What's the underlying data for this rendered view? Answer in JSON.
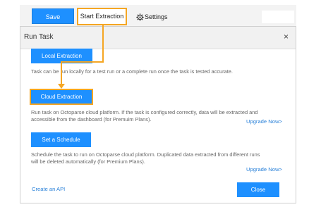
{
  "toolbar": {
    "save_label": "Save",
    "start_extraction_label": "Start Extraction",
    "settings_label": "Settings"
  },
  "dialog": {
    "title": "Run Task",
    "close_x": "×",
    "local": {
      "button_label": "Local Extraction",
      "description": "Task can be run locally for a test run or a complete run once the task is tested accurate."
    },
    "cloud": {
      "button_label": "Cloud Extraction",
      "description_line1": "Run task on Octoparse cloud platform. If the task is configured correctly, data will be extracted and",
      "description_line2": "accessible from the dashboard (for Premuim Plans).",
      "upgrade_link": "Upgrade Now>"
    },
    "schedule": {
      "button_label": "Set a Schedule",
      "description_line1": "Schedule the task to run on Octoparse cloud platform. Duplicated data extracted from different runs",
      "description_line2": "will be deleted automatically (for Premium Plans).",
      "upgrade_link": "Upgrade Now>"
    },
    "create_api_link": "Create an API",
    "close_button_label": "Close"
  },
  "colors": {
    "accent_blue": "#1e90ff",
    "highlight_orange": "#f5a623",
    "link_blue": "#2b82d9"
  }
}
